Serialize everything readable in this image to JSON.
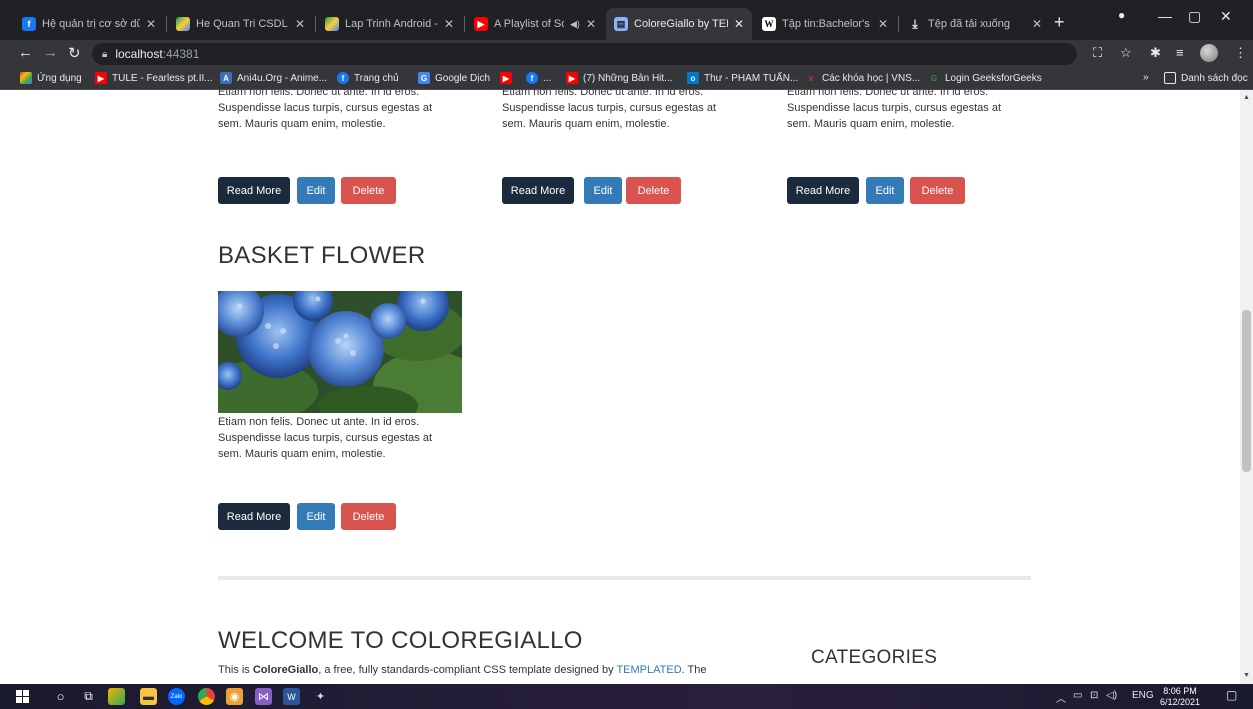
{
  "browser": {
    "tabs": [
      {
        "title": "Hệ quản trị cơ sở dữ li",
        "icon": "facebook-icon"
      },
      {
        "title": "He Quan Tri CSDL (Da",
        "icon": "google-drive-icon"
      },
      {
        "title": "Lap Trinh Android - G",
        "icon": "google-drive-icon"
      },
      {
        "title": "A Playlist of Song",
        "icon": "youtube-icon"
      },
      {
        "title": "ColoreGiallo by TEMP",
        "icon": "page-icon"
      },
      {
        "title": "Tập tin:Bachelor's butt",
        "icon": "wikipedia-icon"
      },
      {
        "title": "Tệp đã tải xuống",
        "icon": "download-icon"
      }
    ],
    "url_host": "localhost",
    "url_port": ":44381",
    "bookmarks": [
      {
        "label": "Ứng dụng"
      },
      {
        "label": "TULE - Fearless pt.II..."
      },
      {
        "label": "Ani4u.Org - Anime..."
      },
      {
        "label": "Trang chủ"
      },
      {
        "label": "Google Dịch"
      },
      {
        "label": "..."
      },
      {
        "label": "(7) Những Bản Hit..."
      },
      {
        "label": "Thư - PHAM TUẤN..."
      },
      {
        "label": "Các khóa học | VNS..."
      },
      {
        "label": "Login GeeksforGeeks"
      }
    ],
    "reading_list": "Danh sách đọc",
    "more_bookmarks": "»"
  },
  "cards_top": [
    {
      "text": "Etiam non felis. Donec ut ante. In id eros. Suspendisse lacus turpis, cursus egestas at sem. Mauris quam enim, molestie."
    },
    {
      "text": "Etiam non felis. Donec ut ante. In id eros. Suspendisse lacus turpis, cursus egestas at sem. Mauris quam enim, molestie."
    },
    {
      "text": "Etiam non felis. Donec ut ante. In id eros. Suspendisse lacus turpis, cursus egestas at sem. Mauris quam enim, molestie."
    }
  ],
  "buttons": {
    "read_more": "Read More",
    "edit": "Edit",
    "delete": "Delete"
  },
  "basket": {
    "title": "BASKET FLOWER",
    "text": "Etiam non felis. Donec ut ante. In id eros. Suspendisse lacus turpis, cursus egestas at sem. Mauris quam enim, molestie."
  },
  "welcome": {
    "title": "WELCOME TO COLOREGIALLO",
    "text_prefix": "This is ",
    "brand": "ColoreGiallo",
    "text_mid": ", a free, fully standards-compliant CSS template designed by ",
    "link": "TEMPLATED",
    "text_suffix": ". The"
  },
  "categories_title": "CATEGORIES",
  "taskbar": {
    "lang": "ENG",
    "time": "8:06 PM",
    "date": "6/12/2021"
  },
  "colors": {
    "read_more": "#1c2a3d",
    "edit": "#337ab7",
    "delete": "#d9534f",
    "link": "#337ab7"
  }
}
